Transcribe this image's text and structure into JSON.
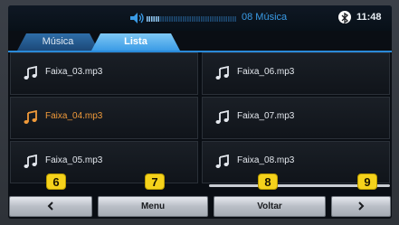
{
  "status_bar": {
    "title": "08 Música",
    "clock": "11:48",
    "volume_icon": "speaker-icon",
    "bluetooth_icon": "bluetooth-icon",
    "volume_level": 0.15,
    "title_color": "#3a9be6"
  },
  "tabs": [
    {
      "label": "Música",
      "active": false
    },
    {
      "label": "Lista",
      "active": true
    }
  ],
  "tracks": [
    {
      "name": "Faixa_03.mp3",
      "playing": false
    },
    {
      "name": "Faixa_06.mp3",
      "playing": false
    },
    {
      "name": "Faixa_04.mp3",
      "playing": true
    },
    {
      "name": "Faixa_07.mp3",
      "playing": false
    },
    {
      "name": "Faixa_05.mp3",
      "playing": false
    },
    {
      "name": "Faixa_08.mp3",
      "playing": false
    }
  ],
  "track_icon": "music-note-icon",
  "active_color": "#f09a3a",
  "buttons": {
    "prev": {
      "label": "",
      "icon": "chevron-left-icon"
    },
    "menu": {
      "label": "Menu"
    },
    "back": {
      "label": "Voltar"
    },
    "next": {
      "label": "",
      "icon": "chevron-right-icon"
    }
  },
  "badges": [
    "6",
    "7",
    "8",
    "9"
  ],
  "badge_color": "#f5d21b"
}
